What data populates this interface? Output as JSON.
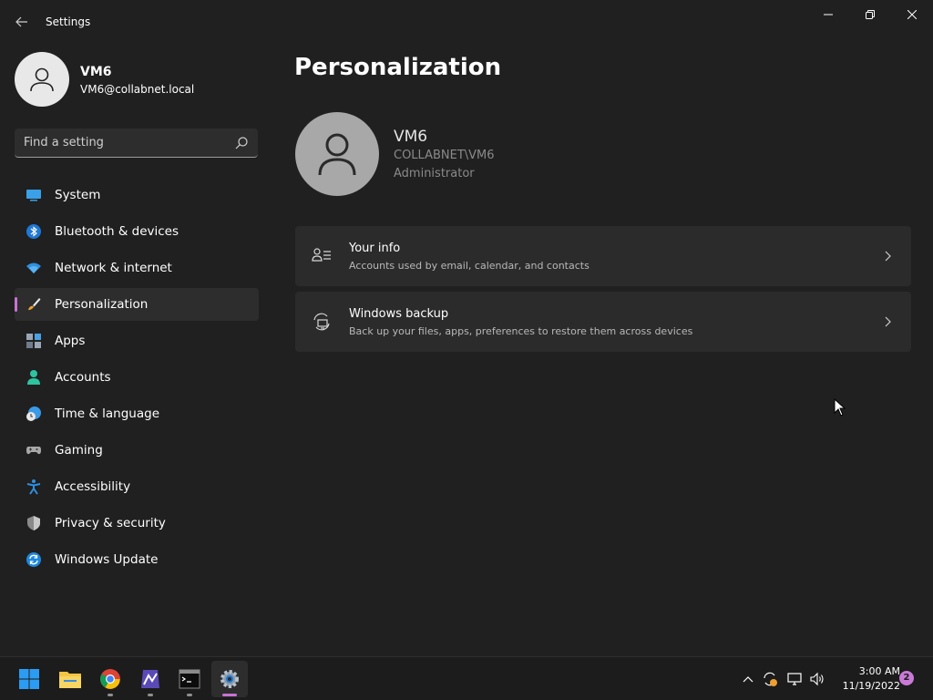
{
  "window": {
    "title": "Settings",
    "controls": [
      "minimize",
      "restore",
      "close"
    ]
  },
  "user": {
    "name": "VM6",
    "email": "VM6@collabnet.local"
  },
  "search": {
    "placeholder": "Find a setting"
  },
  "sidebar": {
    "items": [
      {
        "label": "System",
        "icon": "system-icon"
      },
      {
        "label": "Bluetooth & devices",
        "icon": "bluetooth-icon"
      },
      {
        "label": "Network & internet",
        "icon": "wifi-icon"
      },
      {
        "label": "Personalization",
        "icon": "brush-icon",
        "selected": true
      },
      {
        "label": "Apps",
        "icon": "apps-icon"
      },
      {
        "label": "Accounts",
        "icon": "accounts-icon"
      },
      {
        "label": "Time & language",
        "icon": "globe-clock-icon"
      },
      {
        "label": "Gaming",
        "icon": "gamepad-icon"
      },
      {
        "label": "Accessibility",
        "icon": "accessibility-icon"
      },
      {
        "label": "Privacy & security",
        "icon": "shield-icon"
      },
      {
        "label": "Windows Update",
        "icon": "update-icon"
      }
    ]
  },
  "main": {
    "title": "Personalization",
    "profile": {
      "name": "VM6",
      "domain": "COLLABNET\\VM6",
      "role": "Administrator"
    },
    "cards": [
      {
        "title": "Your info",
        "subtitle": "Accounts used by email, calendar, and contacts",
        "icon": "person-list-icon"
      },
      {
        "title": "Windows backup",
        "subtitle": "Back up your files, apps, preferences to restore them across devices",
        "icon": "backup-icon"
      }
    ]
  },
  "taskbar": {
    "apps": [
      {
        "name": "start",
        "icon": "windows-logo-icon"
      },
      {
        "name": "file-explorer",
        "icon": "folder-icon"
      },
      {
        "name": "chrome",
        "icon": "chrome-icon"
      },
      {
        "name": "app-4",
        "icon": "app-icon"
      },
      {
        "name": "terminal",
        "icon": "terminal-icon"
      },
      {
        "name": "settings",
        "icon": "settings-gear-icon",
        "active": true
      }
    ],
    "time": "3:00 AM",
    "date": "11/19/2022",
    "notifications": "2"
  },
  "colors": {
    "accent": "#c773d3",
    "background": "#202020",
    "card": "#2b2b2b"
  }
}
